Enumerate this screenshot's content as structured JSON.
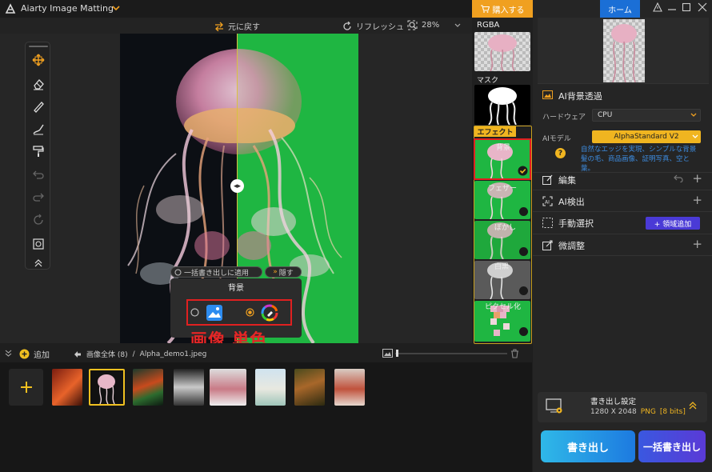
{
  "app": {
    "title": "Aiarty Image Matting"
  },
  "toolbar": {
    "undo_label": "元に戻す",
    "refresh_label": "リフレッシュ",
    "zoom": "28%"
  },
  "popup": {
    "apply_all": "一括書き出しに適用",
    "hide": "隠す",
    "title": "背景",
    "annotation": "画像 単色"
  },
  "bottombar": {
    "add_label": "追加",
    "breadcrumb_all": "画像全体 (8)",
    "separator": "/",
    "filename": "Alpha_demo1.jpeg"
  },
  "effects": {
    "buy_label": "購入する",
    "rgba_label": "RGBA",
    "mask_label": "マスク",
    "effect_tag": "エフェクト",
    "items": [
      {
        "label": "背景"
      },
      {
        "label": "フェザー"
      },
      {
        "label": "ぼかし"
      },
      {
        "label": "白黒"
      },
      {
        "label": "ピクセル化"
      }
    ]
  },
  "rightpanel": {
    "home_label": "ホーム",
    "ai_bg": "AI背景透過",
    "hardware_label": "ハードウェア",
    "hardware_value": "CPU",
    "model_label": "AIモデル",
    "model_value": "AlphaStandard  V2",
    "model_desc": "自然なエッジを実現、シンプルな背景髪の毛、商品画像、証明写真、空と葉。",
    "edit": "編集",
    "ai_detect": "AI検出",
    "manual": "手動選択",
    "add_region": "+ 領域追加",
    "fine_tune": "微調整",
    "export_settings": "書き出し設定",
    "export_size": "1280 X 2048",
    "export_format": "PNG",
    "export_bits": "[8 bits]",
    "export_btn": "書き出し",
    "batch_btn": "一括書き出し"
  },
  "colors": {
    "accent": "#f0a020",
    "brand_blue": "#1b6fd6",
    "matte_green": "#1fb642",
    "annotation_red": "#e52626"
  }
}
